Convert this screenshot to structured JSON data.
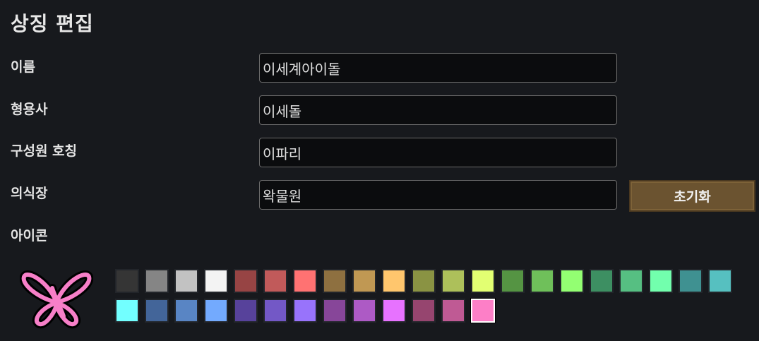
{
  "header": {
    "title": "상징 편집"
  },
  "form": {
    "name": {
      "label": "이름",
      "value": "이세계아이돌"
    },
    "adjective": {
      "label": "형용사",
      "value": "이세돌"
    },
    "member_title": {
      "label": "구성원 호칭",
      "value": "이파리"
    },
    "costume": {
      "label": "의식장",
      "value": "왁물원"
    },
    "icon": {
      "label": "아이콘"
    }
  },
  "reset_button": {
    "label": "초기화"
  },
  "emblem": {
    "icon": "pink-butterfly-icon",
    "color": "#f77fc8"
  },
  "palette": {
    "colors": [
      "#353535",
      "#858585",
      "#c2c2c2",
      "#f3f3f3",
      "#974444",
      "#c15a5a",
      "#ff7272",
      "#8e7040",
      "#c09853",
      "#ffc66d",
      "#8a9343",
      "#adc05a",
      "#e2ff72",
      "#559443",
      "#6fc05a",
      "#93ff72",
      "#3d8f62",
      "#56bf82",
      "#72ffad",
      "#3f9191",
      "#56c0c0",
      "#72ffff",
      "#436599",
      "#5985c4",
      "#73aafe",
      "#57429b",
      "#7358c6",
      "#9873fb",
      "#874699",
      "#ad5ac5",
      "#e772ff",
      "#96456f",
      "#bf5a94",
      "#fd7fc7"
    ],
    "selected_index": 33
  }
}
